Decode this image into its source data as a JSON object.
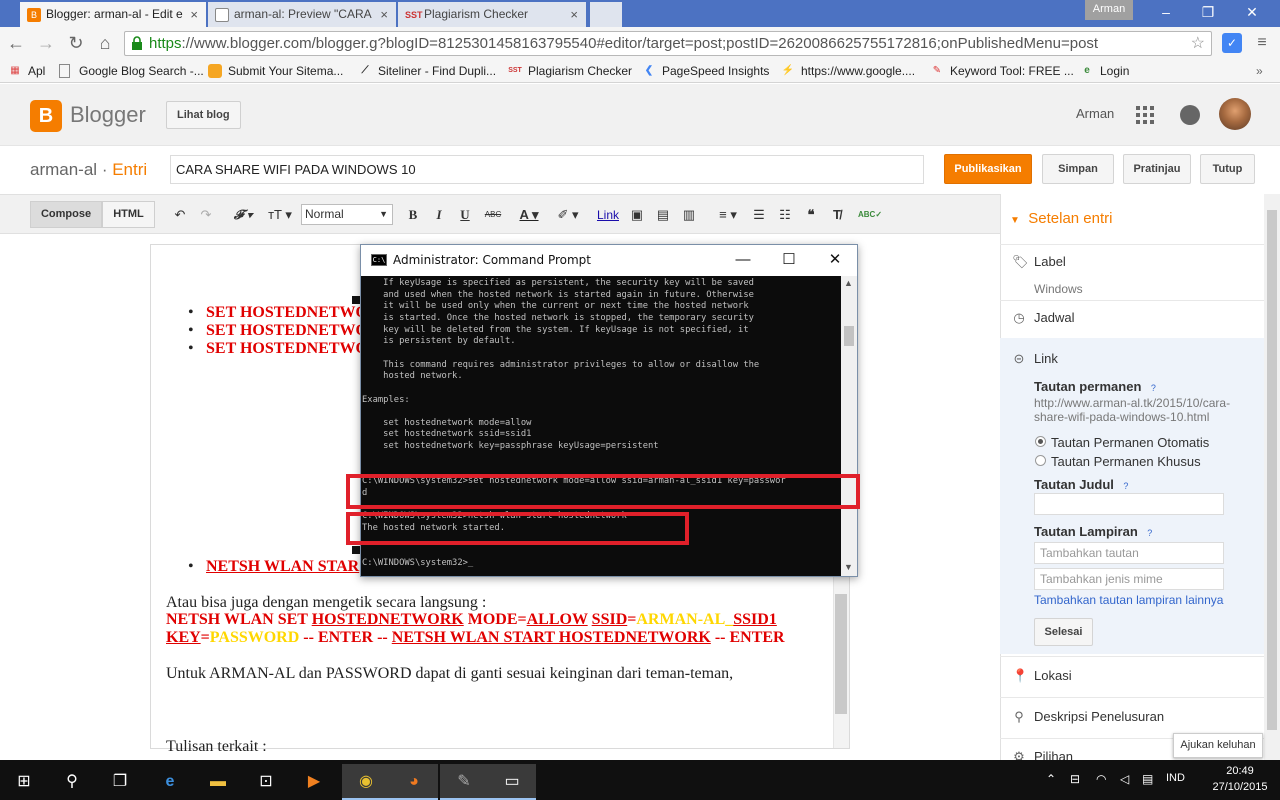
{
  "browser": {
    "tabs": [
      {
        "title": "Blogger: arman-al - Edit e",
        "favicon": "blogger-favicon",
        "active": true
      },
      {
        "title": "arman-al: Preview \"CARA",
        "favicon": "page-favicon",
        "active": false
      },
      {
        "title": "Plagiarism Checker",
        "favicon": "sst-favicon",
        "active": false
      }
    ],
    "user_chip": "Arman",
    "url_https": "https",
    "url_rest": "://www.blogger.com/blogger.g?blogID=8125301458163795540#editor/target=post;postID=2620086625755172816;onPublishedMenu=post",
    "bookmarks": [
      {
        "label": "Apl",
        "icon": "apps-grid-icon"
      },
      {
        "label": "Google Blog Search -...",
        "icon": "page-icon"
      },
      {
        "label": "Submit Your Sitema...",
        "icon": "submit-icon"
      },
      {
        "label": "Siteliner - Find Dupli...",
        "icon": "siteliner-icon"
      },
      {
        "label": "Plagiarism Checker",
        "icon": "sst-icon"
      },
      {
        "label": "PageSpeed Insights",
        "icon": "pagespeed-icon"
      },
      {
        "label": "https://www.google....",
        "icon": "lightning-icon"
      },
      {
        "label": "Keyword Tool: FREE ...",
        "icon": "keyword-icon"
      },
      {
        "label": "Login",
        "icon": "login-icon"
      }
    ]
  },
  "blogger": {
    "brand": "Blogger",
    "view_blog": "Lihat blog",
    "account": "Arman",
    "blog_name": "arman-al",
    "separator": " · ",
    "section": "Entri",
    "post_title": "CARA SHARE WIFI PADA WINDOWS 10",
    "buttons": {
      "publish": "Publikasikan",
      "save": "Simpan",
      "preview": "Pratinjau",
      "close": "Tutup"
    },
    "modes": {
      "compose": "Compose",
      "html": "HTML"
    },
    "font_select": "Normal",
    "link_btn": "Link"
  },
  "editor": {
    "bullets_top": [
      "SET HOSTEDNETWO",
      "SET HOSTEDNETWO",
      "SET HOSTEDNETWO"
    ],
    "bullet_bottom": "NETSH WLAN STAR",
    "para1": "Atau bisa juga dengan mengetik secara langsung :",
    "cmd_line_1a": "NETSH WLAN SET ",
    "cmd_line_1b": "HOSTEDNETWORK",
    "cmd_line_1c": " MODE=",
    "cmd_line_1d": "ALLOW",
    "cmd_line_1e": " ",
    "cmd_line_1f": "SSID",
    "cmd_line_1g": "=",
    "cmd_line_1h": "ARMAN-AL_",
    "cmd_line_1i": "SSID1",
    "cmd_line_2a": "KEY",
    "cmd_line_2b": "=",
    "cmd_line_2c": "PASSWORD",
    "cmd_line_2d": " -- ENTER -- ",
    "cmd_line_2e": "NETSH WLAN START HOSTEDNETWORK",
    "cmd_line_2f": " -- ENTER",
    "para2": "Untuk ARMAN-AL dan PASSWORD dapat di ganti sesuai keinginan dari teman-teman,",
    "para3": "Tulisan terkait :"
  },
  "cmd_window": {
    "title": "Administrator: Command Prompt",
    "lines": [
      "    If keyUsage is specified as persistent, the security key will be saved",
      "    and used when the hosted network is started again in future. Otherwise",
      "    it will be used only when the current or next time the hosted network",
      "    is started. Once the hosted network is stopped, the temporary security",
      "    key will be deleted from the system. If keyUsage is not specified, it",
      "    is persistent by default.",
      "",
      "    This command requires administrator privileges to allow or disallow the",
      "    hosted network.",
      "",
      "Examples:",
      "",
      "    set hostednetwork mode=allow",
      "    set hostednetwork ssid=ssid1",
      "    set hostednetwork key=passphrase keyUsage=persistent",
      "",
      "",
      "C:\\WINDOWS\\system32>set hostednetwork mode=allow ssid=arman-al_ssid1 key=passwor",
      "d",
      "",
      "C:\\WINDOWS\\system32>netsh wlan start hostednetwork",
      "The hosted network started.",
      "",
      "",
      "C:\\WINDOWS\\system32>_"
    ]
  },
  "settings_panel": {
    "heading": "Setelan entri",
    "label_title": "Label",
    "label_value": "Windows",
    "schedule": "Jadwal",
    "link": "Link",
    "permalink_title": "Tautan permanen",
    "permalink_url": "http://www.arman-al.tk/2015/10/cara-share-wifi-pada-windows-10.html",
    "radio_auto": "Tautan Permanen Otomatis",
    "radio_custom": "Tautan Permanen Khusus",
    "title_link": "Tautan Judul",
    "attachment": "Tautan Lampiran",
    "attach_placeholder": "Tambahkan tautan",
    "mime_placeholder": "Tambahkan jenis mime",
    "add_more": "Tambahkan tautan lampiran lainnya",
    "done": "Selesai",
    "location": "Lokasi",
    "search_desc": "Deskripsi Penelusuran",
    "options": "Pilihan",
    "help": "?",
    "feedback": "Ajukan keluhan"
  },
  "taskbar": {
    "lang": "IND",
    "time": "20:49",
    "date": "27/10/2015"
  },
  "colors": {
    "accent": "#f57d00",
    "tabbar": "#4c72c2",
    "highlight_red": "#e0202a",
    "editor_red": "#e00000",
    "editor_yellow": "#ffd700"
  }
}
